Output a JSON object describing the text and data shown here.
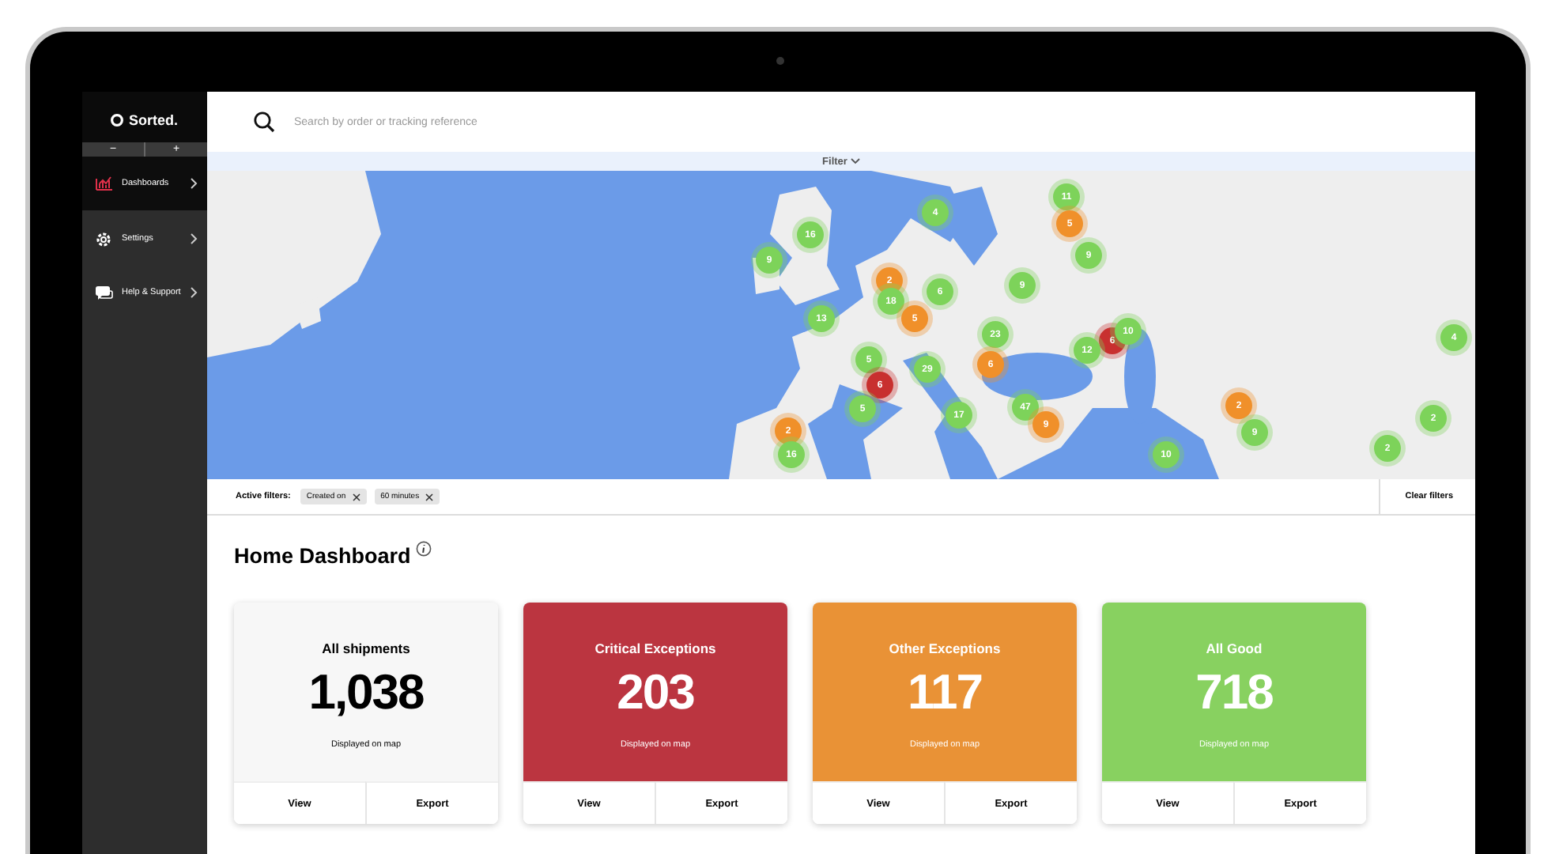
{
  "sidebar": {
    "logo": "Sorted.",
    "zoom_buttons": [
      "−",
      "+"
    ],
    "items": [
      {
        "label": "Dashboards",
        "kind": "chart",
        "selected": true
      },
      {
        "label": "Settings",
        "kind": "gear",
        "selected": false
      },
      {
        "label": "Help & Support",
        "kind": "chat",
        "selected": false
      }
    ]
  },
  "search": {
    "placeholder": "Search by order or tracking reference"
  },
  "filter_toggle": {
    "label": "Filter"
  },
  "map": {
    "markers": [
      {
        "count": "11",
        "color": "#7dd35a"
      },
      {
        "count": "5",
        "color": "#f0902a"
      },
      {
        "count": "9",
        "color": "#7dd35a"
      },
      {
        "count": "4",
        "color": "#7dd35a"
      },
      {
        "count": "16",
        "color": "#7dd35a"
      },
      {
        "count": "9",
        "color": "#7dd35a"
      },
      {
        "count": "2",
        "color": "#f0902a"
      },
      {
        "count": "18",
        "color": "#7dd35a"
      },
      {
        "count": "6",
        "color": "#7dd35a"
      },
      {
        "count": "5",
        "color": "#f0902a"
      },
      {
        "count": "13",
        "color": "#7dd35a"
      },
      {
        "count": "9",
        "color": "#7dd35a"
      },
      {
        "count": "23",
        "color": "#7dd35a"
      },
      {
        "count": "6",
        "color": "#c8302f"
      },
      {
        "count": "12",
        "color": "#7dd35a"
      },
      {
        "count": "10",
        "color": "#7dd35a"
      },
      {
        "count": "5",
        "color": "#7dd35a"
      },
      {
        "count": "6",
        "color": "#c8302f"
      },
      {
        "count": "29",
        "color": "#7dd35a"
      },
      {
        "count": "6",
        "color": "#f0902a"
      },
      {
        "count": "5",
        "color": "#7dd35a"
      },
      {
        "count": "17",
        "color": "#7dd35a"
      },
      {
        "count": "47",
        "color": "#7dd35a"
      },
      {
        "count": "9",
        "color": "#f0902a"
      },
      {
        "count": "2",
        "color": "#f0902a"
      },
      {
        "count": "9",
        "color": "#7dd35a"
      },
      {
        "count": "10",
        "color": "#7dd35a"
      },
      {
        "count": "2",
        "color": "#f0902a"
      },
      {
        "count": "16",
        "color": "#7dd35a"
      },
      {
        "count": "2",
        "color": "#7dd35a"
      },
      {
        "count": "2",
        "color": "#7dd35a"
      },
      {
        "count": "4",
        "color": "#7dd35a"
      }
    ]
  },
  "active_filters": {
    "label": "Active filters:",
    "chips": [
      "Created on",
      "60 minutes"
    ],
    "clear": "Clear filters"
  },
  "title": "Home Dashboard",
  "cards": [
    {
      "title": "All shipments",
      "value": "1,038",
      "note": "Displayed on map",
      "kind": "total",
      "color": "#f7f7f7",
      "actions": [
        "View",
        "Export"
      ]
    },
    {
      "title": "Critical Exceptions",
      "value": "203",
      "note": "Displayed on map",
      "kind": "status",
      "color": "#bb3540",
      "actions": [
        "View",
        "Export"
      ]
    },
    {
      "title": "Other Exceptions",
      "value": "117",
      "note": "Displayed on map",
      "kind": "status",
      "color": "#e99236",
      "actions": [
        "View",
        "Export"
      ]
    },
    {
      "title": "All Good",
      "value": "718",
      "note": "Displayed on map",
      "kind": "status",
      "color": "#88d160",
      "actions": [
        "View",
        "Export"
      ]
    }
  ]
}
